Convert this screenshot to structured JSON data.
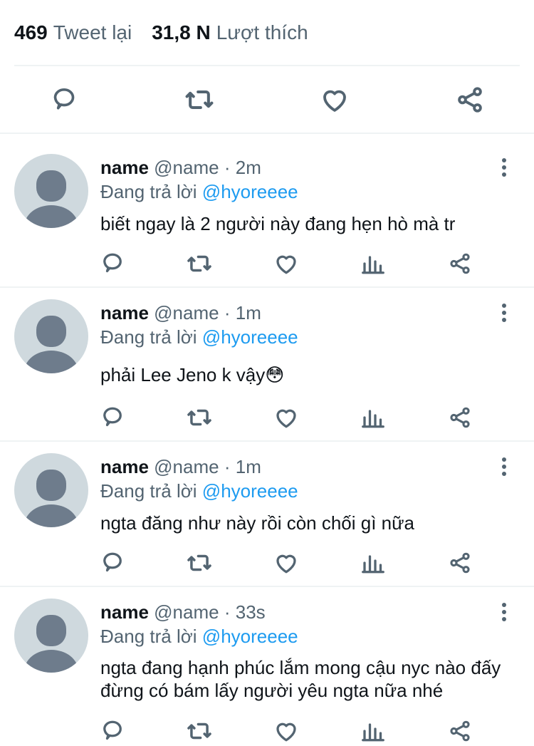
{
  "stats": {
    "retweets_count": "469",
    "retweets_label": "Tweet lại",
    "likes_count": "31,8 N",
    "likes_label": "Lượt thích"
  },
  "icons": {
    "reply": "reply-icon",
    "retweet": "retweet-icon",
    "like": "heart-icon",
    "analytics": "analytics-icon",
    "share": "share-icon",
    "more": "more-vertical-icon"
  },
  "colors": {
    "mention": "#1d9bf0",
    "secondary": "#536471",
    "avatar_bg": "#cfd9de",
    "avatar_fg": "#6e7c8c"
  },
  "replies": [
    {
      "name": "name",
      "handle": "@name",
      "dot": "·",
      "time": "2m",
      "replying_label": "Đang trả lời",
      "mention": "@hyoreeee",
      "text": "biết ngay là 2 người này đang hẹn hò mà tr"
    },
    {
      "name": "name",
      "handle": "@name",
      "dot": "·",
      "time": "1m",
      "replying_label": "Đang trả lời",
      "mention": "@hyoreeee",
      "text": "phải Lee Jeno k vậy😳"
    },
    {
      "name": "name",
      "handle": "@name",
      "dot": "·",
      "time": "1m",
      "replying_label": "Đang trả lời",
      "mention": "@hyoreeee",
      "text": "ngta đăng như này rồi còn chối gì nữa"
    },
    {
      "name": "name",
      "handle": "@name",
      "dot": "·",
      "time": "33s",
      "replying_label": "Đang trả lời",
      "mention": "@hyoreeee",
      "text": "ngta đang hạnh phúc lắm mong cậu nyc nào đấy đừng có bám lấy người yêu ngta nữa nhé"
    }
  ]
}
